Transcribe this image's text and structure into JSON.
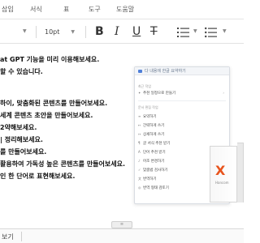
{
  "menubar": {
    "items": [
      "삽입",
      "서식",
      "표",
      "도구",
      "도움말"
    ]
  },
  "toolbar": {
    "font_size": "10pt",
    "bold_label": "B",
    "italic_label": "I",
    "underline_label": "U",
    "strike_label": "T"
  },
  "document": {
    "lines": [
      "at GPT 기능을 미리 이용해보세요.",
      "할 수 있습니다.",
      "하이, 맞춤화된 콘텐츠를 만들어보세요.",
      "세계 콘텐츠 초안을 만들어보세요.",
      "2약해보세요.",
      "| 정리해보세요.",
      "를 만들어보세요.",
      "활용하여 가독성 높은 콘텐츠를 만들어보세요.",
      "인 한 단어로 표현해보세요."
    ]
  },
  "popup": {
    "title": "다 내용에 한글 요약하기",
    "section_recent": "최근 작업",
    "recent_item": "추천 일정으로 만들기",
    "section_edit": "문서 편집 작업",
    "items": [
      "요약하기",
      "간략하게 쓰기",
      "상세하게 쓰기",
      "글 서식 추천 받기",
      "단어 추천 받기",
      "어조 변경하기",
      "맞춤법 검사하기",
      "번역하기",
      "번역 형태 검토기"
    ]
  },
  "product": {
    "logo": "X",
    "caption": "Hancom"
  },
  "statusbar": {
    "label": "보기",
    "handle": "≡"
  }
}
